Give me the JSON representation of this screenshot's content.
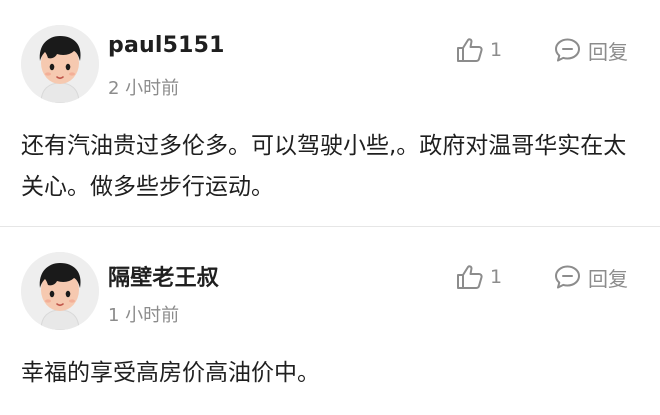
{
  "comments": [
    {
      "username": "paul5151",
      "timestamp": "2 小时前",
      "likes": "1",
      "reply_label": "回复",
      "text": "还有汽油贵过多伦多。可以驾驶小些,。政府对温哥华实在太关心。做多些步行运动。",
      "avatar_icon": "cartoon-boy-avatar-icon"
    },
    {
      "username": "隔壁老王叔",
      "timestamp": "1 小时前",
      "likes": "1",
      "reply_label": "回复",
      "text": "幸福的享受高房价高油价中。",
      "avatar_icon": "cartoon-boy-avatar-icon"
    }
  ],
  "colors": {
    "text": "#1f1f1f",
    "muted": "#8c8c8c",
    "divider": "#e6e6e6",
    "avatar_bg": "#eeeeee",
    "skin": "#f6c9b0",
    "hair": "#1a1a1a"
  },
  "icons": {
    "like": "thumbs-up-icon",
    "reply": "speech-bubble-icon"
  }
}
